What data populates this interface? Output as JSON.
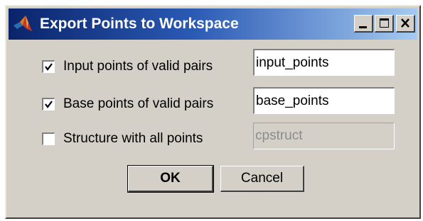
{
  "window": {
    "title": "Export Points to Workspace"
  },
  "title_buttons": {
    "minimize_icon": "minimize-icon",
    "maximize_icon": "maximize-icon",
    "close_icon": "close-icon"
  },
  "options": [
    {
      "label": "Input points of valid pairs",
      "checked": true,
      "variable": "input_points",
      "enabled": true
    },
    {
      "label": "Base points of valid pairs",
      "checked": true,
      "variable": "base_points",
      "enabled": true
    },
    {
      "label": "Structure with all points",
      "checked": false,
      "variable": "cpstruct",
      "enabled": false
    }
  ],
  "buttons": {
    "ok_label": "OK",
    "cancel_label": "Cancel"
  },
  "colors": {
    "titlebar_start": "#0a246a",
    "titlebar_end": "#a6caf0",
    "dialog_face": "#d4d0c8"
  }
}
